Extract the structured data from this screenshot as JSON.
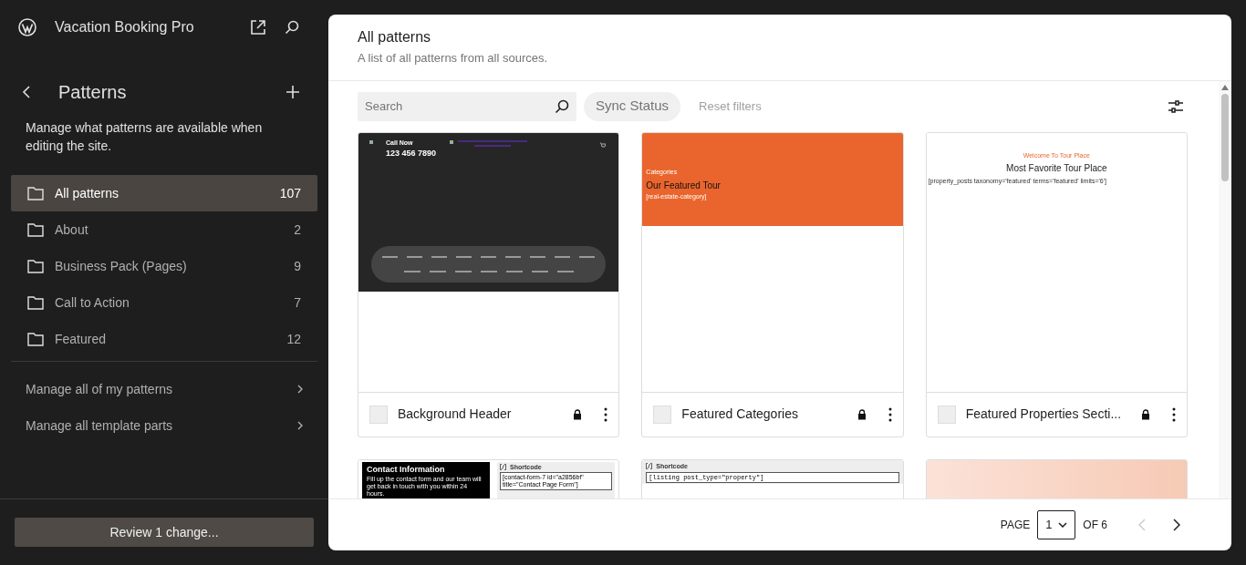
{
  "site": {
    "title": "Vacation Booking Pro"
  },
  "section": {
    "title": "Patterns",
    "description": "Manage what patterns are available when editing the site."
  },
  "categories": [
    {
      "label": "All patterns",
      "count": "107",
      "selected": true
    },
    {
      "label": "About",
      "count": "2",
      "selected": false
    },
    {
      "label": "Business Pack (Pages)",
      "count": "9",
      "selected": false
    },
    {
      "label": "Call to Action",
      "count": "7",
      "selected": false
    },
    {
      "label": "Featured",
      "count": "12",
      "selected": false
    }
  ],
  "links": [
    {
      "label": "Manage all of my patterns"
    },
    {
      "label": "Manage all template parts"
    }
  ],
  "review_button": "Review 1 change...",
  "main": {
    "title": "All patterns",
    "description": "A list of all patterns from all sources."
  },
  "toolbar": {
    "search_placeholder": "Search",
    "sync_status": "Sync Status",
    "reset_filters": "Reset filters"
  },
  "patterns": [
    {
      "title": "Background Header",
      "locked": true,
      "preview": {
        "kind": "header",
        "label": "Call Now",
        "phone": "123 456 7890"
      }
    },
    {
      "title": "Featured Categories",
      "locked": true,
      "preview": {
        "kind": "categories",
        "eyebrow": "Categories",
        "heading": "Our Featured Tour",
        "shortcode": "[real-estate-category]"
      }
    },
    {
      "title": "Featured Properties Secti...",
      "locked": true,
      "preview": {
        "kind": "featured",
        "eyebrow": "Welcome To Tour Place",
        "heading": "Most Favorite Tour Place",
        "shortcode": "[property_posts taxonomy='featured' terms='featured' limits='6']"
      }
    },
    {
      "preview": {
        "kind": "contact",
        "heading": "Contact Information",
        "body": "Fill up the contact form and our team will get back in touch with you within 24 hours.",
        "label": "Shortcode",
        "shortcode": "[contact-form-7 id=\"a2856bf\" title=\"Contact Page Form\"]"
      }
    },
    {
      "preview": {
        "kind": "shortcode",
        "label": "Shortcode",
        "shortcode": "[listing post_type=\"property\"]"
      }
    },
    {
      "preview": {
        "kind": "gradient"
      }
    }
  ],
  "pagination": {
    "page_label": "PAGE",
    "page": "1",
    "of": "OF 6"
  }
}
